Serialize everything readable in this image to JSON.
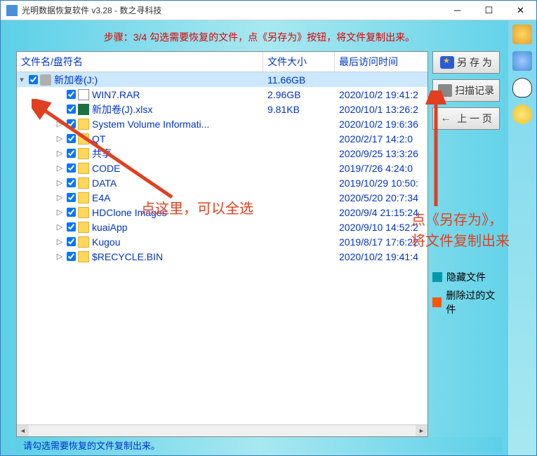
{
  "window": {
    "title": "光明数据恢复软件 v3.28 - 数之寻科技"
  },
  "step_instruction": "步骤：3/4 勾选需要恢复的文件，点《另存为》按钮，将文件复制出来。",
  "columns": {
    "name": "文件名/盘符名",
    "size": "文件大小",
    "date": "最后访问时间"
  },
  "root": {
    "label": "新加卷(J:)",
    "size": "11.66GB",
    "date": ""
  },
  "rows": [
    {
      "indent": 2,
      "expander": "",
      "icon": "file",
      "name": "WIN7.RAR",
      "size": "2.96GB",
      "date": "2020/10/2 19:41:2"
    },
    {
      "indent": 2,
      "expander": "",
      "icon": "xlsx",
      "name": "新加卷(J).xlsx",
      "size": "9.81KB",
      "date": "2020/10/1 13:26:2"
    },
    {
      "indent": 2,
      "expander": "▷",
      "icon": "folder",
      "name": "System Volume Informati...",
      "size": "",
      "date": "2020/10/2 19:6:36"
    },
    {
      "indent": 2,
      "expander": "▷",
      "icon": "folder",
      "name": "QT",
      "size": "",
      "date": "2020/2/17 14:2:0"
    },
    {
      "indent": 2,
      "expander": "▷",
      "icon": "folder",
      "name": "共享",
      "size": "",
      "date": "2020/9/25 13:3:26"
    },
    {
      "indent": 2,
      "expander": "▷",
      "icon": "folder",
      "name": "CODE",
      "size": "",
      "date": "2019/7/26 4:24:0"
    },
    {
      "indent": 2,
      "expander": "▷",
      "icon": "folder",
      "name": "DATA",
      "size": "",
      "date": "2019/10/29 10:50:"
    },
    {
      "indent": 2,
      "expander": "▷",
      "icon": "folder",
      "name": "E4A",
      "size": "",
      "date": "2020/5/20 20:7:34"
    },
    {
      "indent": 2,
      "expander": "▷",
      "icon": "folder",
      "name": "HDClone Images",
      "size": "",
      "date": "2020/9/4 21:15:24"
    },
    {
      "indent": 2,
      "expander": "▷",
      "icon": "folder",
      "name": "kuaiApp",
      "size": "",
      "date": "2020/9/10 14:52:2"
    },
    {
      "indent": 2,
      "expander": "▷",
      "icon": "folder",
      "name": "Kugou",
      "size": "",
      "date": "2019/8/17 17:6:22"
    },
    {
      "indent": 2,
      "expander": "▷",
      "icon": "folder",
      "name": "$RECYCLE.BIN",
      "size": "",
      "date": "2020/10/2 19:41:4"
    }
  ],
  "buttons": {
    "save_as": "另 存 为",
    "scan_log": "扫描记录",
    "prev_page": "上 一 页"
  },
  "legend": {
    "hidden": "隐藏文件",
    "deleted": "删除过的文件"
  },
  "annotations": {
    "select_all": "点这里，可以全选",
    "save_hint": "点《另存为》，将文件复制出来"
  },
  "status": "请勾选需要恢复的文件复制出来。",
  "colors": {
    "hidden": "#0099aa",
    "deleted": "#ff5500"
  }
}
